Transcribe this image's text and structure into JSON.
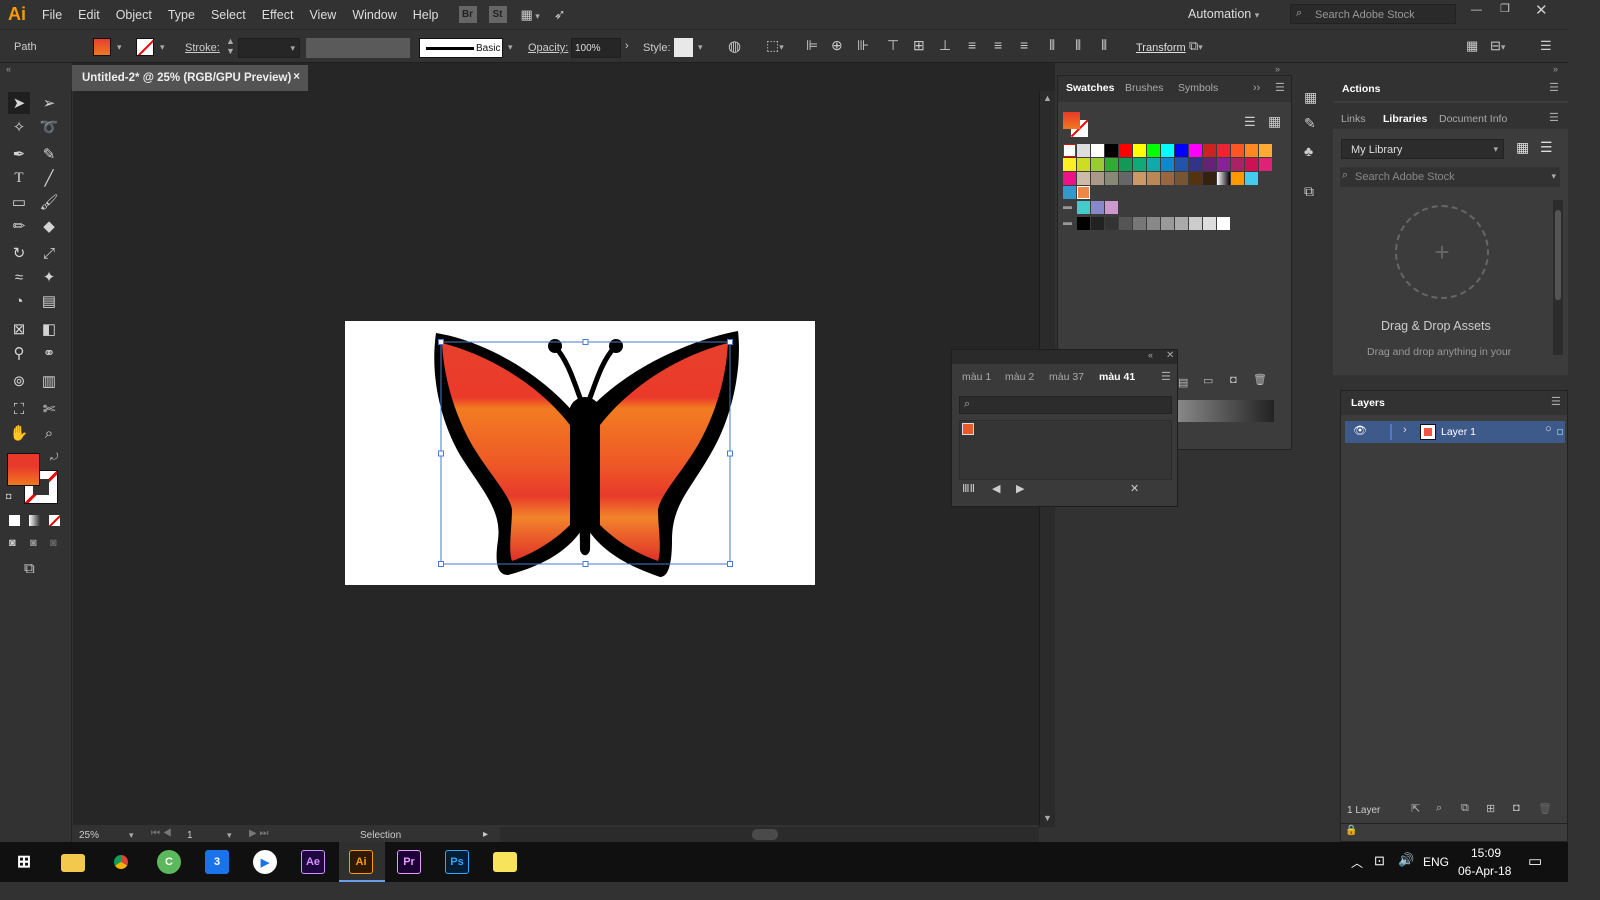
{
  "app": {
    "logo": "Ai",
    "bridge": "Br",
    "stock": "St"
  },
  "menu": [
    "File",
    "Edit",
    "Object",
    "Type",
    "Select",
    "Effect",
    "View",
    "Window",
    "Help"
  ],
  "workspace": {
    "label": "Automation",
    "search_placeholder": "Search Adobe Stock"
  },
  "control": {
    "selection_type": "Path",
    "stroke_label": "Stroke:",
    "brush_label": "Basic",
    "opacity_label": "Opacity:",
    "opacity_value": "100%",
    "style_label": "Style:",
    "transform_label": "Transform"
  },
  "document": {
    "tab_title": "Untitled-2* @ 25% (RGB/GPU Preview)",
    "close": "×"
  },
  "status": {
    "zoom": "25%",
    "artboard": "1",
    "tool": "Selection"
  },
  "swatches_panel": {
    "tabs": [
      "Swatches",
      "Brushes",
      "Symbols"
    ]
  },
  "libraries_panel": {
    "tabs": [
      "Actions",
      "Links",
      "Libraries",
      "Document Info"
    ],
    "library_name": "My Library",
    "search_placeholder": "Search Adobe Stock",
    "drop_title": "Drag & Drop Assets",
    "drop_desc": "Drag and drop anything in your",
    "plus": "+"
  },
  "layers_panel": {
    "title": "Layers",
    "layer_name": "Layer 1",
    "footer": "1 Layer"
  },
  "float_panel": {
    "tabs": [
      "màu 1",
      "màu 2",
      "màu 37",
      "màu 41"
    ]
  },
  "taskbar": {
    "language": "ENG",
    "time": "15:09",
    "date": "06-Apr-18",
    "ae": "Ae",
    "ai": "Ai",
    "pr": "Pr",
    "ps": "Ps"
  },
  "colors": {
    "accent": "#ff9a00",
    "selection": "#4a7bd0",
    "butterfly_top": "#e83a2a",
    "butterfly_mid": "#f07820"
  }
}
